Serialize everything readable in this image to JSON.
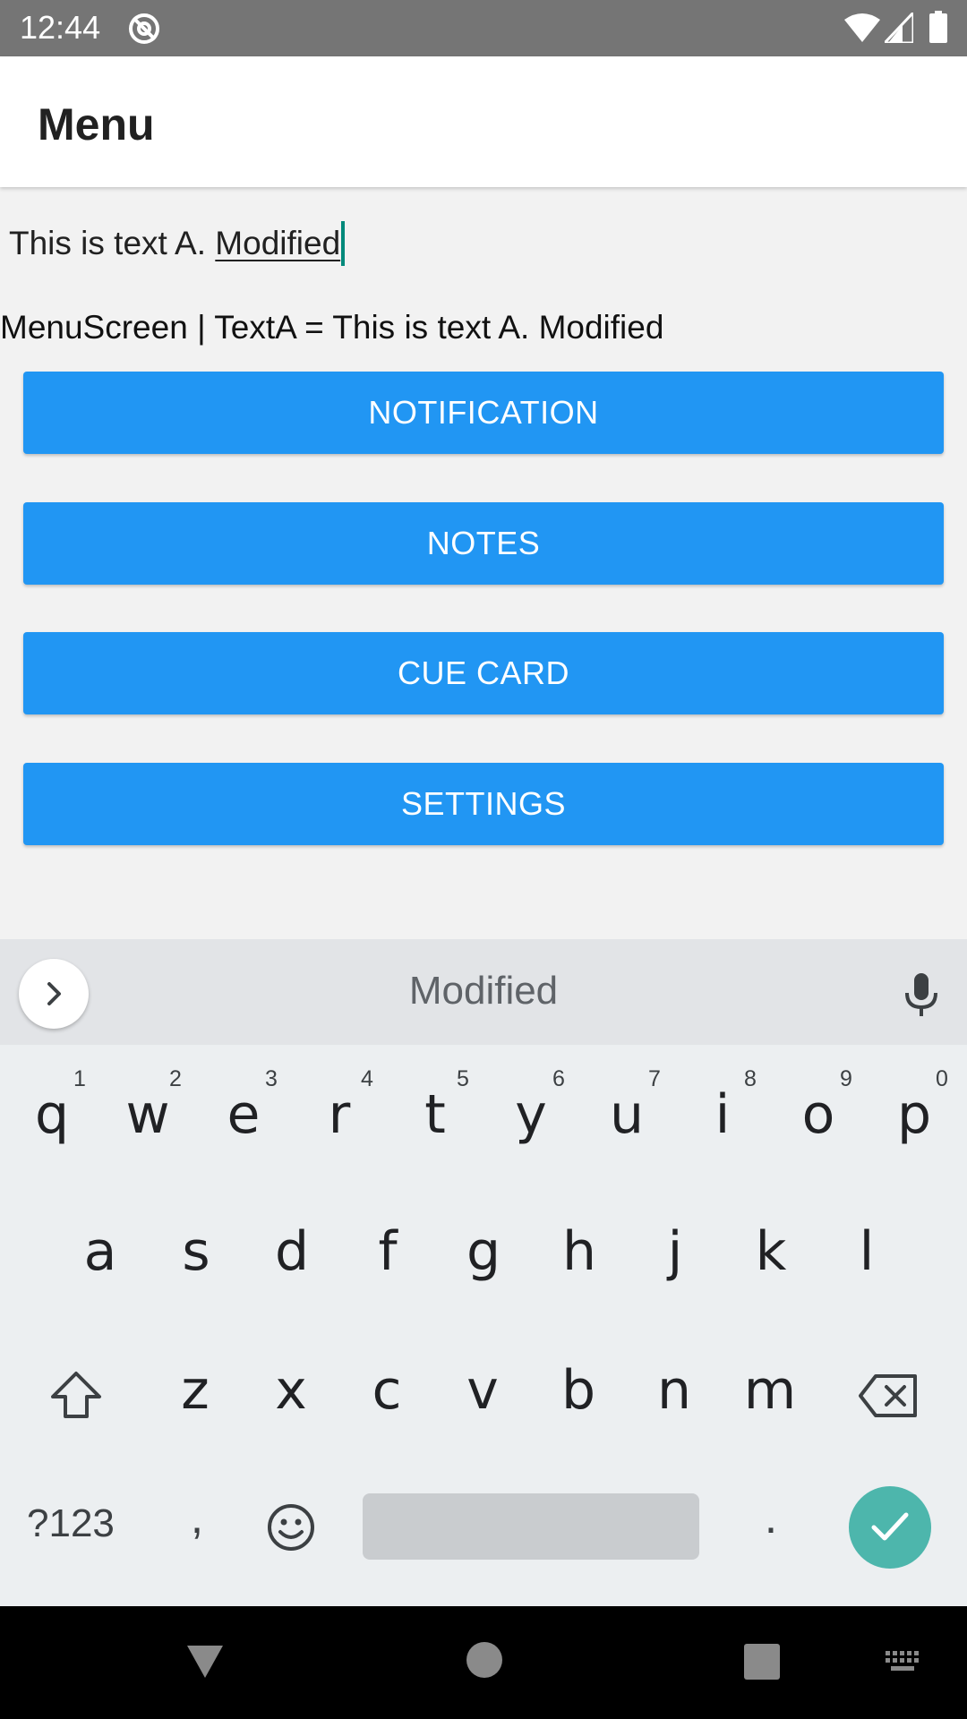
{
  "status_bar": {
    "time": "12:44"
  },
  "app_bar": {
    "title": "Menu"
  },
  "text_field": {
    "value_prefix": "This is text A. ",
    "value_underlined": "Modified"
  },
  "status_line": "MenuScreen | TextA = This is text A. Modified",
  "buttons": [
    {
      "label": "NOTIFICATION"
    },
    {
      "label": "NOTES"
    },
    {
      "label": "CUE CARD"
    },
    {
      "label": "SETTINGS"
    }
  ],
  "keyboard": {
    "suggestion": "Modified",
    "row1": [
      "q",
      "w",
      "e",
      "r",
      "t",
      "y",
      "u",
      "i",
      "o",
      "p"
    ],
    "row1_hints": [
      "1",
      "2",
      "3",
      "4",
      "5",
      "6",
      "7",
      "8",
      "9",
      "0"
    ],
    "row2": [
      "a",
      "s",
      "d",
      "f",
      "g",
      "h",
      "j",
      "k",
      "l"
    ],
    "row3": [
      "z",
      "x",
      "c",
      "v",
      "b",
      "n",
      "m"
    ],
    "symbols_label": "?123",
    "comma": ",",
    "period": "."
  },
  "colors": {
    "accent": "#2196f3",
    "status_bar": "#757575",
    "enter": "#4db6ac",
    "cursor": "#00897b"
  }
}
